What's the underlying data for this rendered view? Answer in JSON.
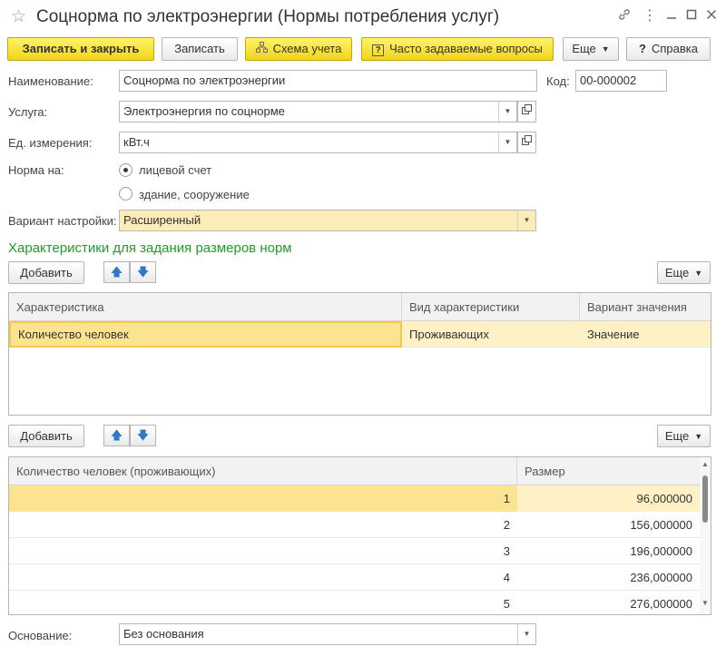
{
  "window": {
    "title": "Соцнорма по электроэнергии (Нормы потребления услуг)",
    "icons": [
      "star-icon",
      "link-icon",
      "more-icon",
      "minimize-icon",
      "maximize-icon",
      "close-icon"
    ]
  },
  "toolbar": {
    "save_close": "Записать и закрыть",
    "save": "Записать",
    "scheme": "Схема учета",
    "faq": "Часто задаваемые вопросы",
    "more": "Еще",
    "help": "Справка"
  },
  "form": {
    "name_label": "Наименование:",
    "name_value": "Соцнорма по электроэнергии",
    "code_label": "Код:",
    "code_value": "00-000002",
    "service_label": "Услуга:",
    "service_value": "Электроэнергия по соцнорме",
    "unit_label": "Ед. измерения:",
    "unit_value": "кВт.ч",
    "norm_label": "Норма на:",
    "norm_options": [
      {
        "label": "лицевой счет",
        "selected": true
      },
      {
        "label": "здание, сооружение",
        "selected": false
      }
    ],
    "variant_label": "Вариант настройки:",
    "variant_value": "Расширенный",
    "basis_label": "Основание:",
    "basis_value": "Без основания"
  },
  "characteristics": {
    "section_title": "Характеристики для задания размеров норм",
    "add_label": "Добавить",
    "more_label": "Еще",
    "columns": [
      "Характеристика",
      "Вид характеристики",
      "Вариант значения"
    ],
    "rows": [
      {
        "name": "Количество человек",
        "kind": "Проживающих",
        "variant": "Значение"
      }
    ]
  },
  "sizes": {
    "add_label": "Добавить",
    "more_label": "Еще",
    "columns": [
      "Количество человек (проживающих)",
      "Размер"
    ],
    "rows": [
      {
        "count": "1",
        "size": "96,000000"
      },
      {
        "count": "2",
        "size": "156,000000"
      },
      {
        "count": "3",
        "size": "196,000000"
      },
      {
        "count": "4",
        "size": "236,000000"
      },
      {
        "count": "5",
        "size": "276,000000"
      }
    ]
  }
}
